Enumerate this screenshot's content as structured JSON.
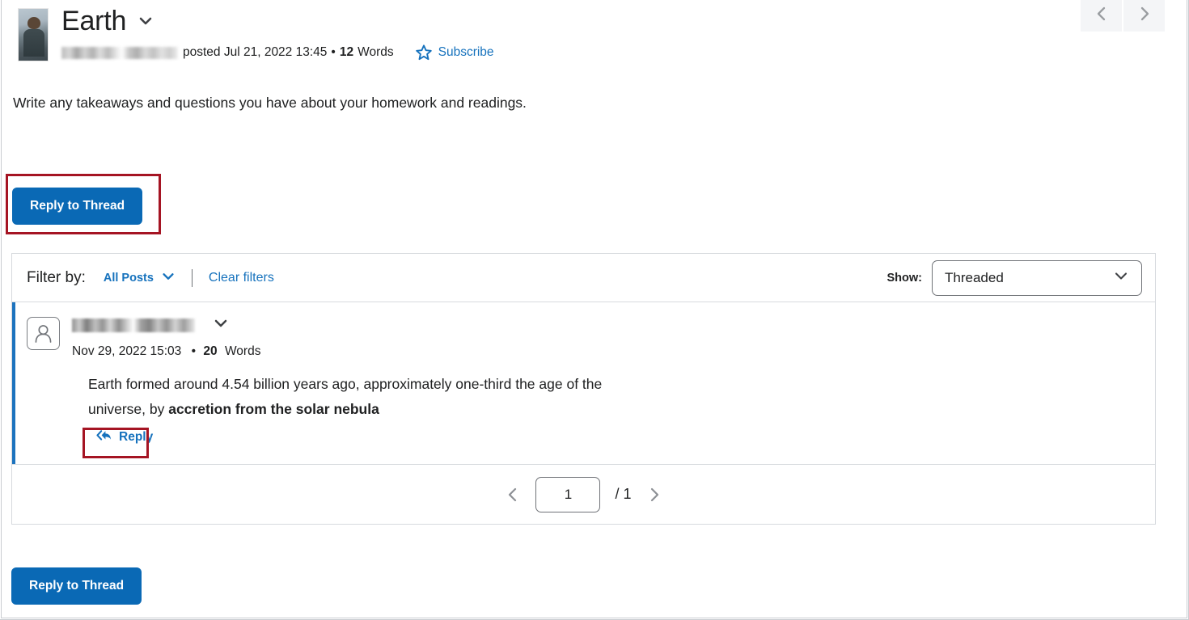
{
  "header": {
    "title": "Earth",
    "title_caret_icon": "chevron-down-icon",
    "author_photo_icon": "user-photo-avatar",
    "author_name_redacted": "",
    "posted_text": "posted Jul 21, 2022 13:45",
    "meta_separator": "•",
    "word_count": "12",
    "word_label": "Words",
    "subscribe_label": "Subscribe",
    "subscribe_icon": "star-icon",
    "prev_icon": "chevron-left-icon",
    "next_icon": "chevron-right-icon"
  },
  "thread": {
    "description": "Write any takeaways and questions you have about your homework and readings."
  },
  "actions": {
    "reply_to_thread_label": "Reply to Thread"
  },
  "filter_bar": {
    "filter_by_label": "Filter by:",
    "filter_value": "All Posts",
    "filter_caret_icon": "chevron-down-icon",
    "clear_filters_label": "Clear filters",
    "show_label": "Show:",
    "show_value": "Threaded",
    "show_caret_icon": "chevron-down-icon"
  },
  "post": {
    "avatar_icon": "user-silhouette-icon",
    "author_name_redacted": "",
    "author_caret_icon": "chevron-down-icon",
    "timestamp": "Nov 29, 2022 15:03",
    "meta_separator": "•",
    "word_count": "20",
    "word_label": "Words",
    "body_text_plain": "Earth formed around 4.54 billion years ago, approximately one-third the age of the universe, by ",
    "body_text_bold": "accretion from the solar nebula",
    "reply_label": "Reply",
    "reply_icon": "reply-arrow-icon"
  },
  "pagination": {
    "prev_icon": "chevron-left-icon",
    "current_page": "1",
    "total_pages": "/ 1",
    "next_icon": "chevron-right-icon"
  },
  "colors": {
    "primary_blue": "#0a69b5",
    "link_blue": "#1672bd",
    "accent_bar": "#1d73be",
    "annotation_red": "#a51423",
    "border_gray": "#d7dade"
  }
}
